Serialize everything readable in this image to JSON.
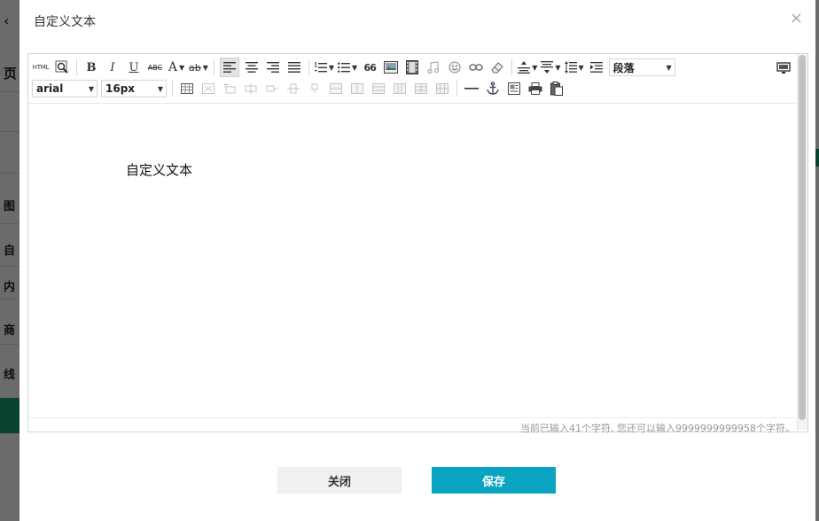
{
  "background": {
    "tabs": [
      "页",
      "",
      "图",
      "自",
      "内",
      "商",
      "线"
    ],
    "back_arrow": "‹"
  },
  "modal": {
    "title": "自定义文本",
    "close_glyph": "×"
  },
  "toolbar": {
    "html_label": "HTML",
    "bold": "B",
    "italic": "I",
    "underline": "U",
    "strike": "ABC",
    "font_color": "A",
    "highlight": "ab",
    "quote": "66",
    "paragraph_value": "段落",
    "font_family_value": "arial",
    "font_size_value": "16px"
  },
  "editor": {
    "content": "自定义文本",
    "wordcount": "当前已输入41个字符, 您还可以输入9999999999958个字符。"
  },
  "footer": {
    "close_label": "关闭",
    "save_label": "保存"
  },
  "colors": {
    "save": "#09a4c2",
    "close_bg": "#f0f0f0",
    "bg_green": "#13a36b"
  }
}
